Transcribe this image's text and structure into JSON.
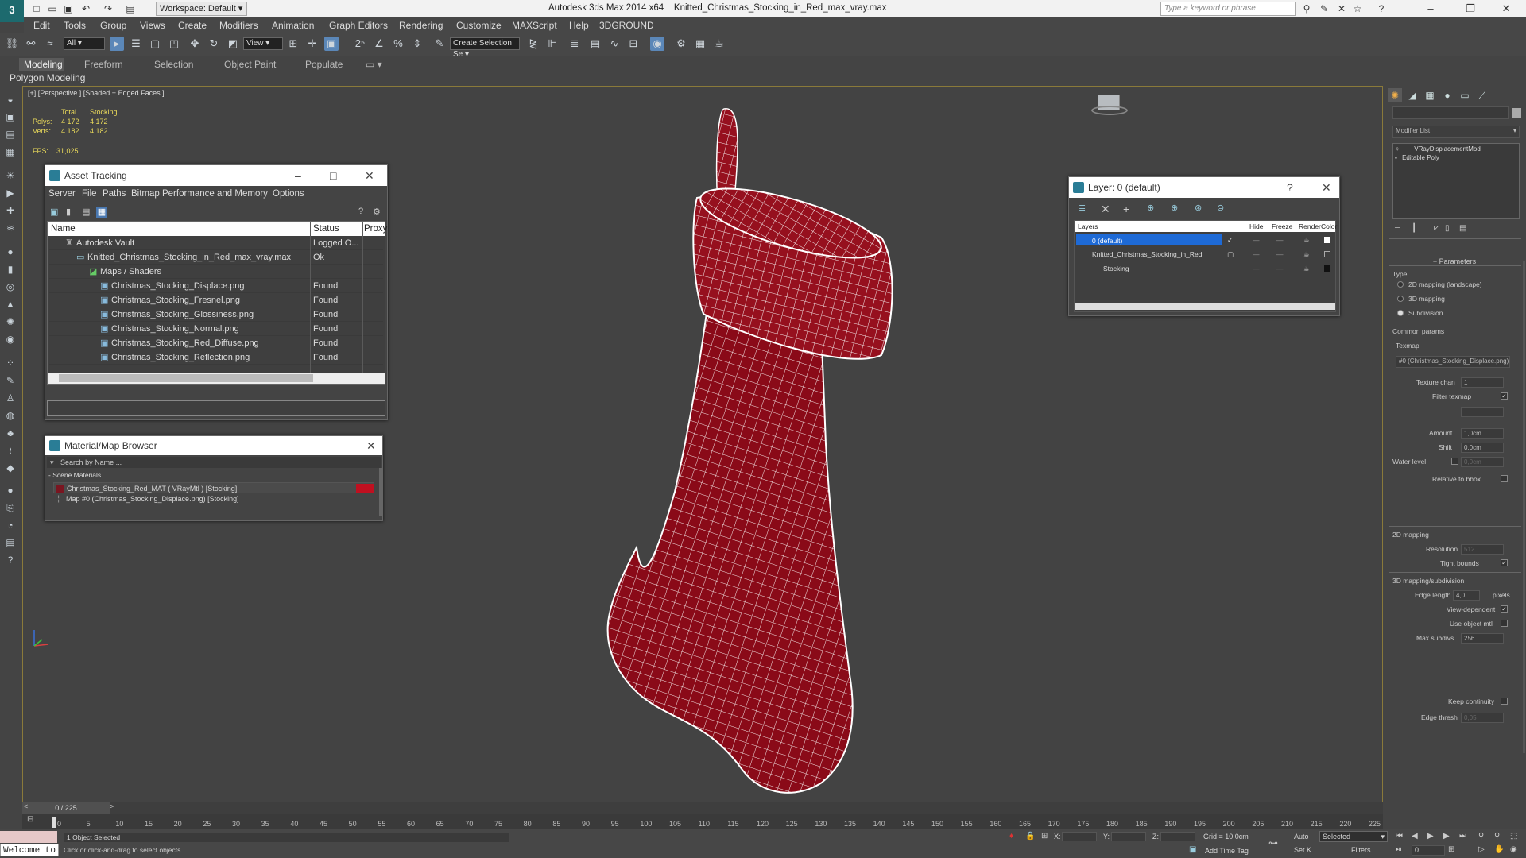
{
  "window": {
    "app_title": "Autodesk 3ds Max  2014 x64",
    "file_name": "Knitted_Christmas_Stocking_in_Red_max_vray.max",
    "workspace": "Workspace: Default",
    "search_placeholder": "Type a keyword or phrase"
  },
  "menu": [
    "Edit",
    "Tools",
    "Group",
    "Views",
    "Create",
    "Modifiers",
    "Animation",
    "Graph Editors",
    "Rendering",
    "Customize",
    "MAXScript",
    "Help",
    "3DGROUND"
  ],
  "toolbar": {
    "selection_filter": "All",
    "ref_coord": "View",
    "named_selection": "Create Selection Se"
  },
  "ribbon": {
    "tabs": [
      "Modeling",
      "Freeform",
      "Selection",
      "Object Paint",
      "Populate"
    ],
    "active_tab": "Modeling",
    "sub_label": "Polygon Modeling"
  },
  "viewport": {
    "label": "[+] [Perspective ] [Shaded + Edged Faces ]",
    "stats_header_total": "Total",
    "stats_header_obj": "Stocking",
    "polys_label": "Polys:",
    "polys_total": "4 172",
    "polys_obj": "4 172",
    "verts_label": "Verts:",
    "verts_total": "4 182",
    "verts_obj": "4 182",
    "fps_label": "FPS:",
    "fps_value": "31,025"
  },
  "asset_tracking": {
    "title": "Asset Tracking",
    "menu": [
      "Server",
      "File",
      "Paths",
      "Bitmap Performance and Memory",
      "Options"
    ],
    "columns": [
      "Name",
      "Status",
      "Proxy"
    ],
    "rows": [
      {
        "name": "Autodesk Vault",
        "status": "Logged O..."
      },
      {
        "name": "Knitted_Christmas_Stocking_in_Red_max_vray.max",
        "status": "Ok"
      },
      {
        "name": "Maps / Shaders",
        "status": ""
      },
      {
        "name": "Christmas_Stocking_Displace.png",
        "status": "Found"
      },
      {
        "name": "Christmas_Stocking_Fresnel.png",
        "status": "Found"
      },
      {
        "name": "Christmas_Stocking_Glossiness.png",
        "status": "Found"
      },
      {
        "name": "Christmas_Stocking_Normal.png",
        "status": "Found"
      },
      {
        "name": "Christmas_Stocking_Red_Diffuse.png",
        "status": "Found"
      },
      {
        "name": "Christmas_Stocking_Reflection.png",
        "status": "Found"
      }
    ]
  },
  "material_browser": {
    "title": "Material/Map Browser",
    "search_placeholder": "Search by Name ...",
    "section": "- Scene Materials",
    "items": [
      "Christmas_Stocking_Red_MAT ( VRayMtl ) [Stocking]",
      "Map #0 (Christmas_Stocking_Displace.png) [Stocking]"
    ]
  },
  "layer_panel": {
    "title": "Layer: 0 (default)",
    "columns": [
      "Layers",
      "Hide",
      "Freeze",
      "Render",
      "Color"
    ],
    "rows": [
      "0 (default)",
      "Knitted_Christmas_Stocking_in_Red",
      "Stocking"
    ]
  },
  "command_panel": {
    "modifier_list": "Modifier List",
    "stack": [
      "VRayDisplacementMod",
      "Editable Poly"
    ],
    "rollout": "Parameters",
    "type_label": "Type",
    "type_options": [
      "2D mapping (landscape)",
      "3D mapping",
      "Subdivision"
    ],
    "common_params": "Common params",
    "texmap_label": "Texmap",
    "texmap_value": "#0 (Christmas_Stocking_Displace.png)",
    "texture_chan_label": "Texture chan",
    "texture_chan_value": "1",
    "filter_texmap": "Filter texmap",
    "amount_label": "Amount",
    "amount_value": "1,0cm",
    "shift_label": "Shift",
    "shift_value": "0,0cm",
    "water_level_label": "Water level",
    "water_level_value": "0,0cm",
    "relative_bbox": "Relative to bbox",
    "mapping2d": "2D mapping",
    "resolution_label": "Resolution",
    "resolution_value": "512",
    "tight_bounds": "Tight bounds",
    "mapping3d": "3D mapping/subdivision",
    "edge_length_label": "Edge length",
    "edge_length_value": "4,0",
    "pixels": "pixels",
    "view_dependent": "View-dependent",
    "use_object_mtl": "Use object mtl",
    "max_subdivs_label": "Max subdivs",
    "max_subdivs_value": "256",
    "keep_continuity": "Keep continuity",
    "edge_thresh_label": "Edge thresh",
    "edge_thresh_value": "0,05"
  },
  "timeline": {
    "frame_slider": "0 / 225",
    "ticks": [
      "0",
      "5",
      "10",
      "15",
      "20",
      "25",
      "30",
      "35",
      "40",
      "45",
      "50",
      "55",
      "60",
      "65",
      "70",
      "75",
      "80",
      "85",
      "90",
      "95",
      "100",
      "105",
      "110",
      "115",
      "120",
      "125",
      "130",
      "135",
      "140",
      "145",
      "150",
      "155",
      "160",
      "165",
      "170",
      "175",
      "180",
      "185",
      "190",
      "195",
      "200",
      "205",
      "210",
      "215",
      "220",
      "225"
    ]
  },
  "status": {
    "maxscript": "Welcome to",
    "selection": "1 Object Selected",
    "prompt": "Click or click-and-drag to select objects",
    "x_label": "X:",
    "y_label": "Y:",
    "z_label": "Z:",
    "grid": "Grid = 10,0cm",
    "add_time_tag": "Add Time Tag",
    "auto": "Auto",
    "set_key": "Set K.",
    "key_filter": "Selected",
    "filters": "Filters...",
    "frame": "0"
  },
  "colors": {
    "viewport_bg": "#434343",
    "stocking_red": "#8a0a18",
    "wire": "#ffffff",
    "stats_yellow": "#e8d85a",
    "selection_blue": "#1e6ad6"
  }
}
